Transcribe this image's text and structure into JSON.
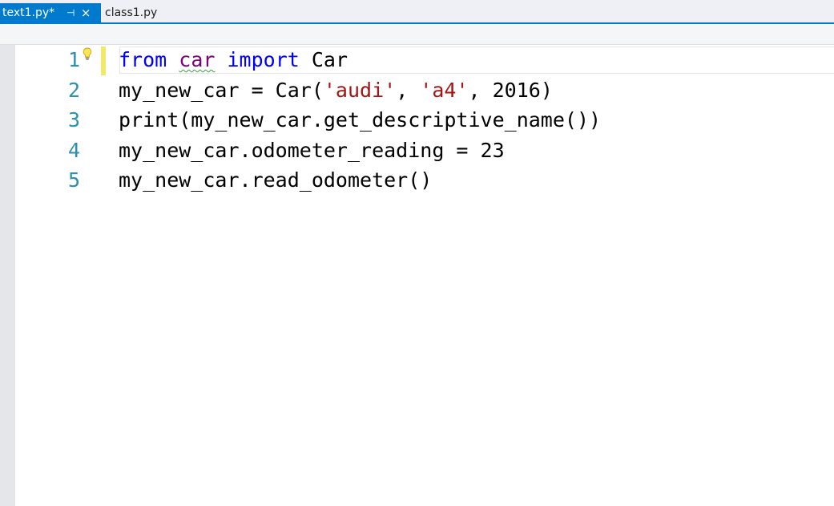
{
  "tabs": {
    "active": {
      "label": "text1.py*",
      "pin_glyph": "⊣",
      "close_glyph": "×"
    },
    "inactive": {
      "label": "class1.py"
    }
  },
  "editor": {
    "lines": [
      {
        "number": "1",
        "tokens": [
          {
            "t": "from",
            "c": "kw"
          },
          {
            "t": " "
          },
          {
            "t": "car",
            "c": "mod squiggle"
          },
          {
            "t": " "
          },
          {
            "t": "import",
            "c": "kw"
          },
          {
            "t": " Car"
          }
        ]
      },
      {
        "number": "2",
        "tokens": [
          {
            "t": "my_new_car = Car("
          },
          {
            "t": "'audi'",
            "c": "str"
          },
          {
            "t": ", "
          },
          {
            "t": "'a4'",
            "c": "str"
          },
          {
            "t": ", 2016)"
          }
        ]
      },
      {
        "number": "3",
        "tokens": [
          {
            "t": "print(my_new_car.get_descriptive_name())"
          }
        ]
      },
      {
        "number": "4",
        "tokens": [
          {
            "t": "my_new_car.odometer_reading = 23"
          }
        ]
      },
      {
        "number": "5",
        "tokens": [
          {
            "t": "my_new_car.read_odometer()"
          }
        ]
      }
    ],
    "colors": {
      "keyword": "#0000ff",
      "module": "#800080",
      "string": "#a31515",
      "line_number": "#2b91af",
      "accent": "#007acc"
    }
  }
}
